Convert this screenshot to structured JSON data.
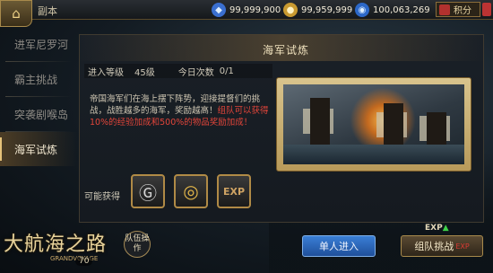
{
  "topbar": {
    "home_icon": "mansion-icon",
    "title": "副本",
    "resources": [
      {
        "name": "blue-gem",
        "icon": "diamond-icon",
        "value": "99,999,900"
      },
      {
        "name": "gold",
        "icon": "coin-icon",
        "value": "99,959,999"
      },
      {
        "name": "energy",
        "icon": "drop-icon",
        "value": "100,063,269"
      }
    ],
    "score_label": "积分"
  },
  "menu": {
    "items": [
      {
        "label": "进军尼罗河",
        "active": false
      },
      {
        "label": "霸主挑战",
        "active": false
      },
      {
        "label": "突袭剧喉岛",
        "active": false
      },
      {
        "label": "海军试炼",
        "active": true
      }
    ]
  },
  "panel": {
    "title": "海军试炼",
    "entry_level_label": "进入等级",
    "entry_level_value": "45级",
    "today_count_label": "今日次数",
    "today_count_value": "0/1",
    "description_normal": "帝国海军们在海上摆下阵势，迎接提督们的挑战，战胜越多的海军，奖励越高！",
    "description_highlight": "组队可以获得10%的经验加成和500%的物品奖励加成！",
    "rewards_label": "可能获得",
    "rewards": [
      {
        "name": "silver-coin",
        "icon": "g-coin-icon"
      },
      {
        "name": "gold-coin",
        "icon": "gold-coin-icon"
      },
      {
        "name": "exp",
        "icon": "exp-icon",
        "text": "EXP"
      }
    ]
  },
  "bottom": {
    "logo_text": "大航海之路",
    "logo_sub": "GRANDVOYAGE",
    "level": "70",
    "team_button": "队伍操作",
    "single_button": "单人进入",
    "team_challenge_button": "组队挑战",
    "team_challenge_extra": "EXP",
    "exp_label": "EXP",
    "colors": {
      "accent_blue": "#2f6bc4",
      "accent_gold": "#a88a4c",
      "highlight_red": "#e3453a"
    }
  }
}
